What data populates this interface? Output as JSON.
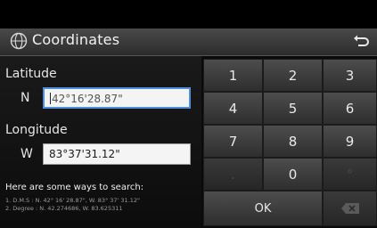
{
  "header": {
    "title": "Coordinates",
    "title_icon": "globe-icon",
    "back_icon": "back-arrow-icon"
  },
  "latitude": {
    "label": "Latitude",
    "direction": "N",
    "value": "42°16'28.87\""
  },
  "longitude": {
    "label": "Longitude",
    "direction": "W",
    "value": "83°37'31.12\""
  },
  "help": {
    "title": "Here are some ways to search:",
    "lines": [
      "1. D.M.S : N. 42° 16' 28.87\", W. 83° 37' 31.12\"",
      "2. Degree : N. 42.274686, W. 83.625311"
    ]
  },
  "keypad": {
    "keys": [
      "1",
      "2",
      "3",
      "4",
      "5",
      "6",
      "7",
      "8",
      "9",
      ".",
      "0",
      "°"
    ],
    "ok_label": "OK",
    "delete_icon": "backspace-icon"
  },
  "colors": {
    "focus_border": "#4f8fe0",
    "key_face": "#3d3d3d"
  }
}
